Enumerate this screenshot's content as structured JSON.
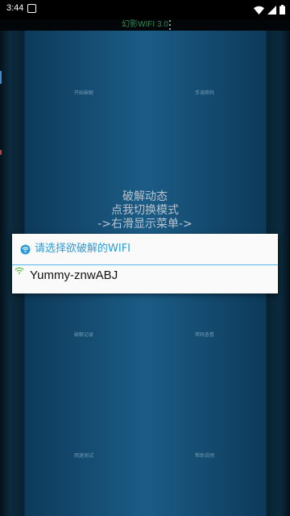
{
  "status_bar": {
    "time": "3:44",
    "notification_icon": "notification-box-icon",
    "wifi_icon": "wifi-signal-icon",
    "cell_icon": "cell-signal-icon",
    "battery_icon": "battery-icon"
  },
  "app_bar": {
    "title": "幻影WIFI 3.0",
    "menu_icon": "overflow-menu-icon"
  },
  "background_labels": {
    "top_left": "开始破解",
    "top_right": "手调密码",
    "mid_left": "破解记录",
    "mid_right": "密码查看",
    "bottom_left": "网速测试",
    "bottom_right": "帮助说明"
  },
  "center_message": {
    "line1": "破解动态",
    "line2": "点我切换模式",
    "line3": "->右滑显示菜单->"
  },
  "dialog": {
    "title": "请选择欲破解的WIFI",
    "icon": "wifi-crack-icon",
    "items": [
      {
        "ssid": "Yummy-znwABJ",
        "icon": "wifi-signal-icon"
      }
    ]
  },
  "colors": {
    "accent": "#2b9bd8",
    "title_green": "#2e8b57",
    "wifi_green": "#5cbf4a"
  }
}
